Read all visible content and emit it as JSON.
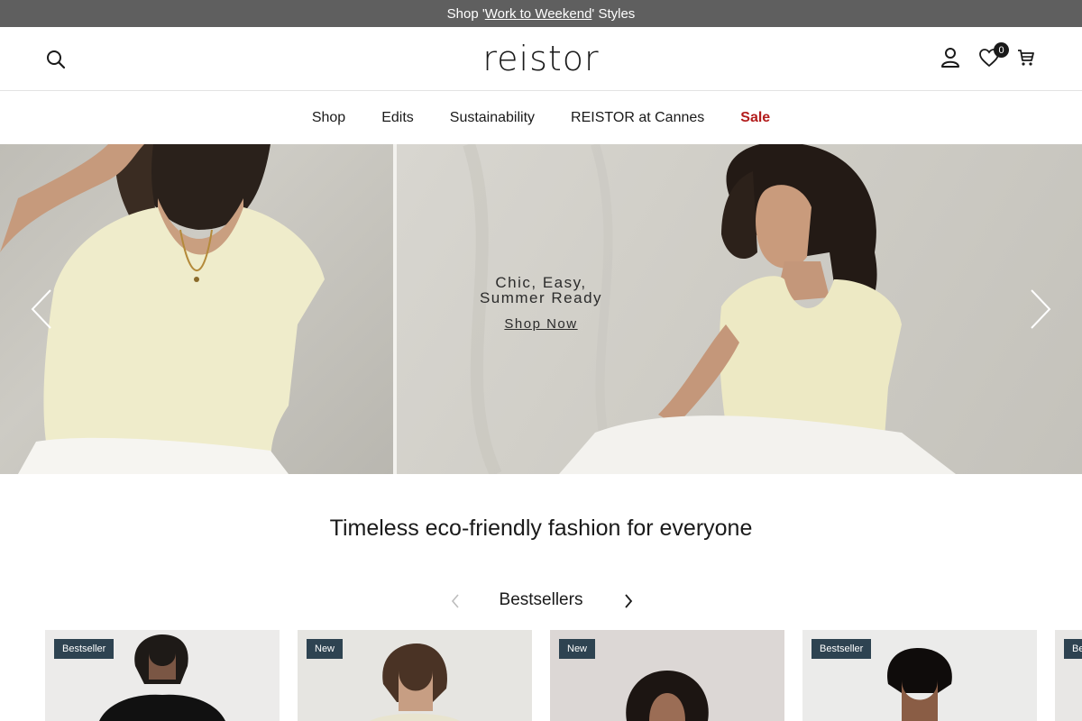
{
  "announcement": {
    "prefix": "Shop '",
    "link": "Work to Weekend",
    "suffix": "' Styles"
  },
  "header": {
    "logo": "reistor",
    "wishlist_count": "0",
    "icons": [
      "search-icon",
      "account-icon",
      "heart-icon",
      "cart-icon"
    ]
  },
  "nav": {
    "items": [
      {
        "label": "Shop"
      },
      {
        "label": "Edits"
      },
      {
        "label": "Sustainability"
      },
      {
        "label": "REISTOR at Cannes"
      },
      {
        "label": "Sale"
      }
    ],
    "sale_color": "#b31d1d"
  },
  "hero": {
    "headline": "Chic, Easy,\nSummer Ready",
    "cta": "Shop Now"
  },
  "tagline": "Timeless eco-friendly fashion for everyone",
  "bestsellers": {
    "title": "Bestsellers",
    "products": [
      {
        "badge": "Bestseller"
      },
      {
        "badge": "New"
      },
      {
        "badge": "New"
      },
      {
        "badge": "Bestseller"
      },
      {
        "badge": "Be"
      }
    ]
  },
  "colors": {
    "announcement_bg": "#5f5f5f",
    "badge_bg": "#2e4351"
  }
}
